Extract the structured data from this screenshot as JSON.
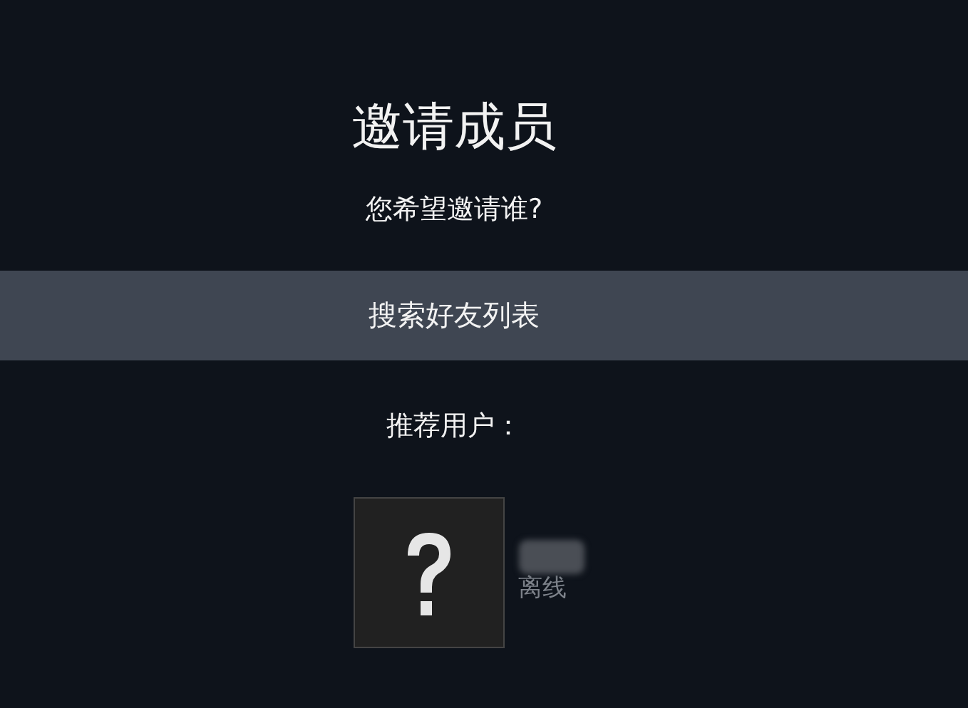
{
  "title": "邀请成员",
  "question": "您希望邀请谁?",
  "search_button": "搜索好友列表",
  "recommended_label": "推荐用户：",
  "recommended_users": [
    {
      "status": "离线",
      "online": false
    }
  ]
}
